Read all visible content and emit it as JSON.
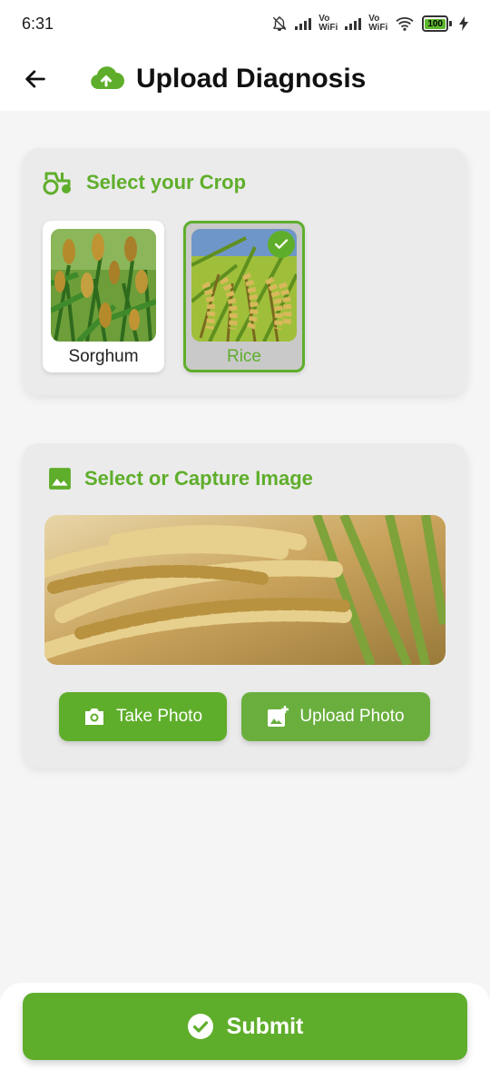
{
  "status_bar": {
    "time": "6:31",
    "vowifi_top": "Vo",
    "vowifi_bottom": "WiFi",
    "battery": "100"
  },
  "header": {
    "title": "Upload Diagnosis",
    "back_icon": "arrow-left-icon",
    "title_icon": "cloud-upload-icon"
  },
  "crop_section": {
    "heading": "Select your Crop",
    "icon": "tractor-icon",
    "crops": [
      {
        "label": "Sorghum",
        "selected": false
      },
      {
        "label": "Rice",
        "selected": true
      }
    ]
  },
  "image_section": {
    "heading": "Select or Capture Image",
    "icon": "image-icon",
    "take_photo_label": "Take Photo",
    "upload_photo_label": "Upload Photo"
  },
  "submit_label": "Submit",
  "colors": {
    "accent": "#5fae2b",
    "card_bg": "#ebebeb",
    "page_bg": "#f5f5f5"
  }
}
